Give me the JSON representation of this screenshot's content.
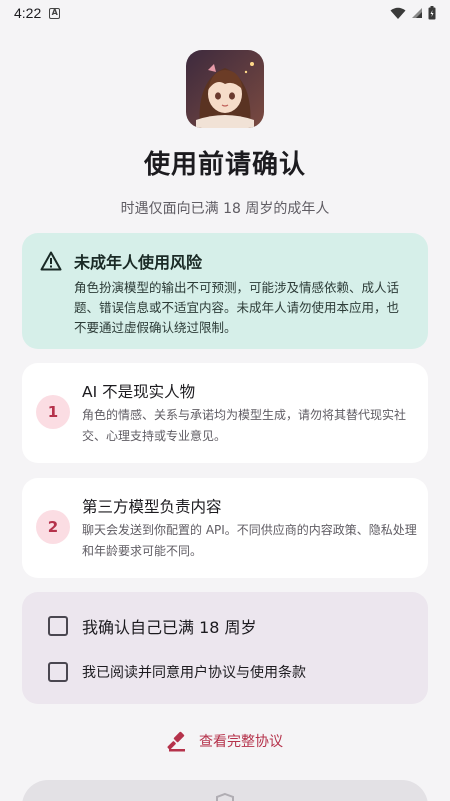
{
  "status_bar": {
    "time": "4:22",
    "notification_glyph": "A"
  },
  "header": {
    "title": "使用前请确认",
    "subtitle": "时遇仅面向已满 18 周岁的成年人"
  },
  "warning": {
    "title": "未成年人使用风险",
    "body": "角色扮演模型的输出不可预测，可能涉及情感依赖、成人话题、错误信息或不适宜内容。未成年人请勿使用本应用，也不要通过虚假确认绕过限制。",
    "color": "#d6efe9"
  },
  "notices": [
    {
      "number": "1",
      "title": "AI 不是现实人物",
      "body": "角色的情感、关系与承诺均为模型生成，请勿将其替代现实社交、心理支持或专业意见。"
    },
    {
      "number": "2",
      "title": "第三方模型负责内容",
      "body": "聊天会发送到你配置的 API。不同供应商的内容政策、隐私处理和年龄要求可能不同。"
    }
  ],
  "confirmations": [
    {
      "label": "我确认自己已满 18 周岁",
      "checked": false
    },
    {
      "label": "我已阅读并同意用户协议与使用条款",
      "checked": false
    }
  ],
  "agreement_link": {
    "label": "查看完整协议",
    "icon": "gavel-icon"
  },
  "accent_color": "#b5324b",
  "bottom_button": {
    "icon": "shield-icon"
  }
}
